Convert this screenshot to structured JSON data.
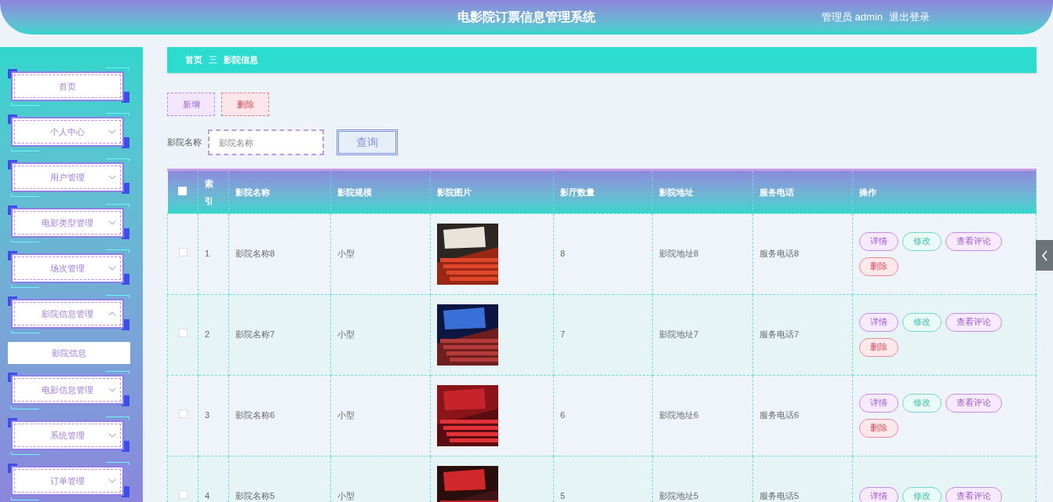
{
  "header": {
    "title": "电影院订票信息管理系统",
    "user": "管理员 admin",
    "logout": "退出登录"
  },
  "sidebar": {
    "items": [
      {
        "kind": "link",
        "label": "首页"
      },
      {
        "kind": "menu",
        "label": "个人中心",
        "expanded": false
      },
      {
        "kind": "menu",
        "label": "用户管理",
        "expanded": false
      },
      {
        "kind": "menu",
        "label": "电影类型管理",
        "expanded": false
      },
      {
        "kind": "menu",
        "label": "场次管理",
        "expanded": false
      },
      {
        "kind": "menu",
        "label": "影院信息管理",
        "expanded": true,
        "children": [
          {
            "label": "影院信息",
            "selected": true
          }
        ]
      },
      {
        "kind": "menu",
        "label": "电影信息管理",
        "expanded": false
      },
      {
        "kind": "menu",
        "label": "系统管理",
        "expanded": false
      },
      {
        "kind": "menu",
        "label": "订单管理",
        "expanded": false
      }
    ]
  },
  "breadcrumb": {
    "items": [
      "首页",
      "影院信息"
    ],
    "separator": "三"
  },
  "toolbar": {
    "add": "新增",
    "delete": "删除"
  },
  "search": {
    "label": "影院名称",
    "placeholder": "影院名称",
    "button": "查询"
  },
  "table": {
    "select_all": {
      "checked": false
    },
    "columns": [
      "索引",
      "影院名称",
      "影院规模",
      "影院图片",
      "影厅数量",
      "影院地址",
      "服务电话",
      "操作"
    ],
    "rows": [
      {
        "checked": false,
        "index": "1",
        "name": "影院名称8",
        "scale": "小型",
        "image": {
          "kind": "picture"
        },
        "halls": "8",
        "address": "影院地址8",
        "phone": "服务电话8",
        "actions": [
          {
            "kind": "detail",
            "label": "详情"
          },
          {
            "kind": "edit",
            "label": "修改"
          },
          {
            "kind": "comments",
            "label": "查看评论"
          },
          {
            "kind": "delete",
            "label": "删除"
          }
        ]
      },
      {
        "checked": false,
        "index": "2",
        "name": "影院名称7",
        "scale": "小型",
        "image": {
          "kind": "picture"
        },
        "halls": "7",
        "address": "影院地址7",
        "phone": "服务电话7",
        "actions": [
          {
            "kind": "detail",
            "label": "详情"
          },
          {
            "kind": "edit",
            "label": "修改"
          },
          {
            "kind": "comments",
            "label": "查看评论"
          },
          {
            "kind": "delete",
            "label": "删除"
          }
        ]
      },
      {
        "checked": false,
        "index": "3",
        "name": "影院名称6",
        "scale": "小型",
        "image": {
          "kind": "picture"
        },
        "halls": "6",
        "address": "影院地址6",
        "phone": "服务电话6",
        "actions": [
          {
            "kind": "detail",
            "label": "详情"
          },
          {
            "kind": "edit",
            "label": "修改"
          },
          {
            "kind": "comments",
            "label": "查看评论"
          },
          {
            "kind": "delete",
            "label": "删除"
          }
        ]
      },
      {
        "checked": false,
        "index": "4",
        "name": "影院名称5",
        "scale": "小型",
        "image": {
          "kind": "picture"
        },
        "halls": "5",
        "address": "影院地址5",
        "phone": "服务电话5",
        "actions": [
          {
            "kind": "detail",
            "label": "详情"
          },
          {
            "kind": "edit",
            "label": "修改"
          },
          {
            "kind": "comments",
            "label": "查看评论"
          }
        ]
      }
    ]
  }
}
